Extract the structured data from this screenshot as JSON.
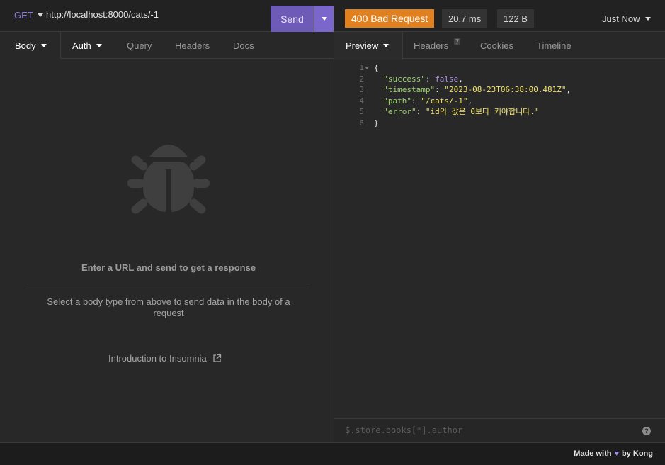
{
  "request": {
    "method": "GET",
    "url": "http://localhost:8000/cats/-1",
    "send_label": "Send",
    "tabs": {
      "body": "Body",
      "auth": "Auth",
      "query": "Query",
      "headers": "Headers",
      "docs": "Docs"
    },
    "empty": {
      "title": "Enter a URL and send to get a response",
      "description": "Select a body type from above to send data in the body of a request",
      "intro_link": "Introduction to Insomnia"
    }
  },
  "response": {
    "status": "400 Bad Request",
    "status_color": "#e0801e",
    "time": "20.7 ms",
    "size": "122 B",
    "history_label": "Just Now",
    "tabs": {
      "preview": "Preview",
      "headers": "Headers",
      "headers_count": "7",
      "cookies": "Cookies",
      "timeline": "Timeline"
    },
    "body_lines": [
      {
        "num": "1",
        "text": "{"
      },
      {
        "num": "2",
        "key": "\"success\"",
        "value": "false",
        "value_type": "bool"
      },
      {
        "num": "3",
        "key": "\"timestamp\"",
        "value": "\"2023-08-23T06:38:00.481Z\"",
        "value_type": "string"
      },
      {
        "num": "4",
        "key": "\"path\"",
        "value": "\"/cats/-1\"",
        "value_type": "string"
      },
      {
        "num": "5",
        "key": "\"error\"",
        "value": "\"id의 값은 0보다 커야합니다.\"",
        "value_type": "string"
      },
      {
        "num": "6",
        "text": "}"
      }
    ],
    "filter_placeholder": "$.store.books[*].author",
    "help_label": "?"
  },
  "footer": {
    "made_with": "Made with",
    "heart": "♥",
    "by": "by Kong"
  },
  "colors": {
    "accent": "#6e5bb8",
    "json_key": "#9bd36b",
    "json_string": "#f2e36b",
    "json_bool": "#b495e8"
  }
}
